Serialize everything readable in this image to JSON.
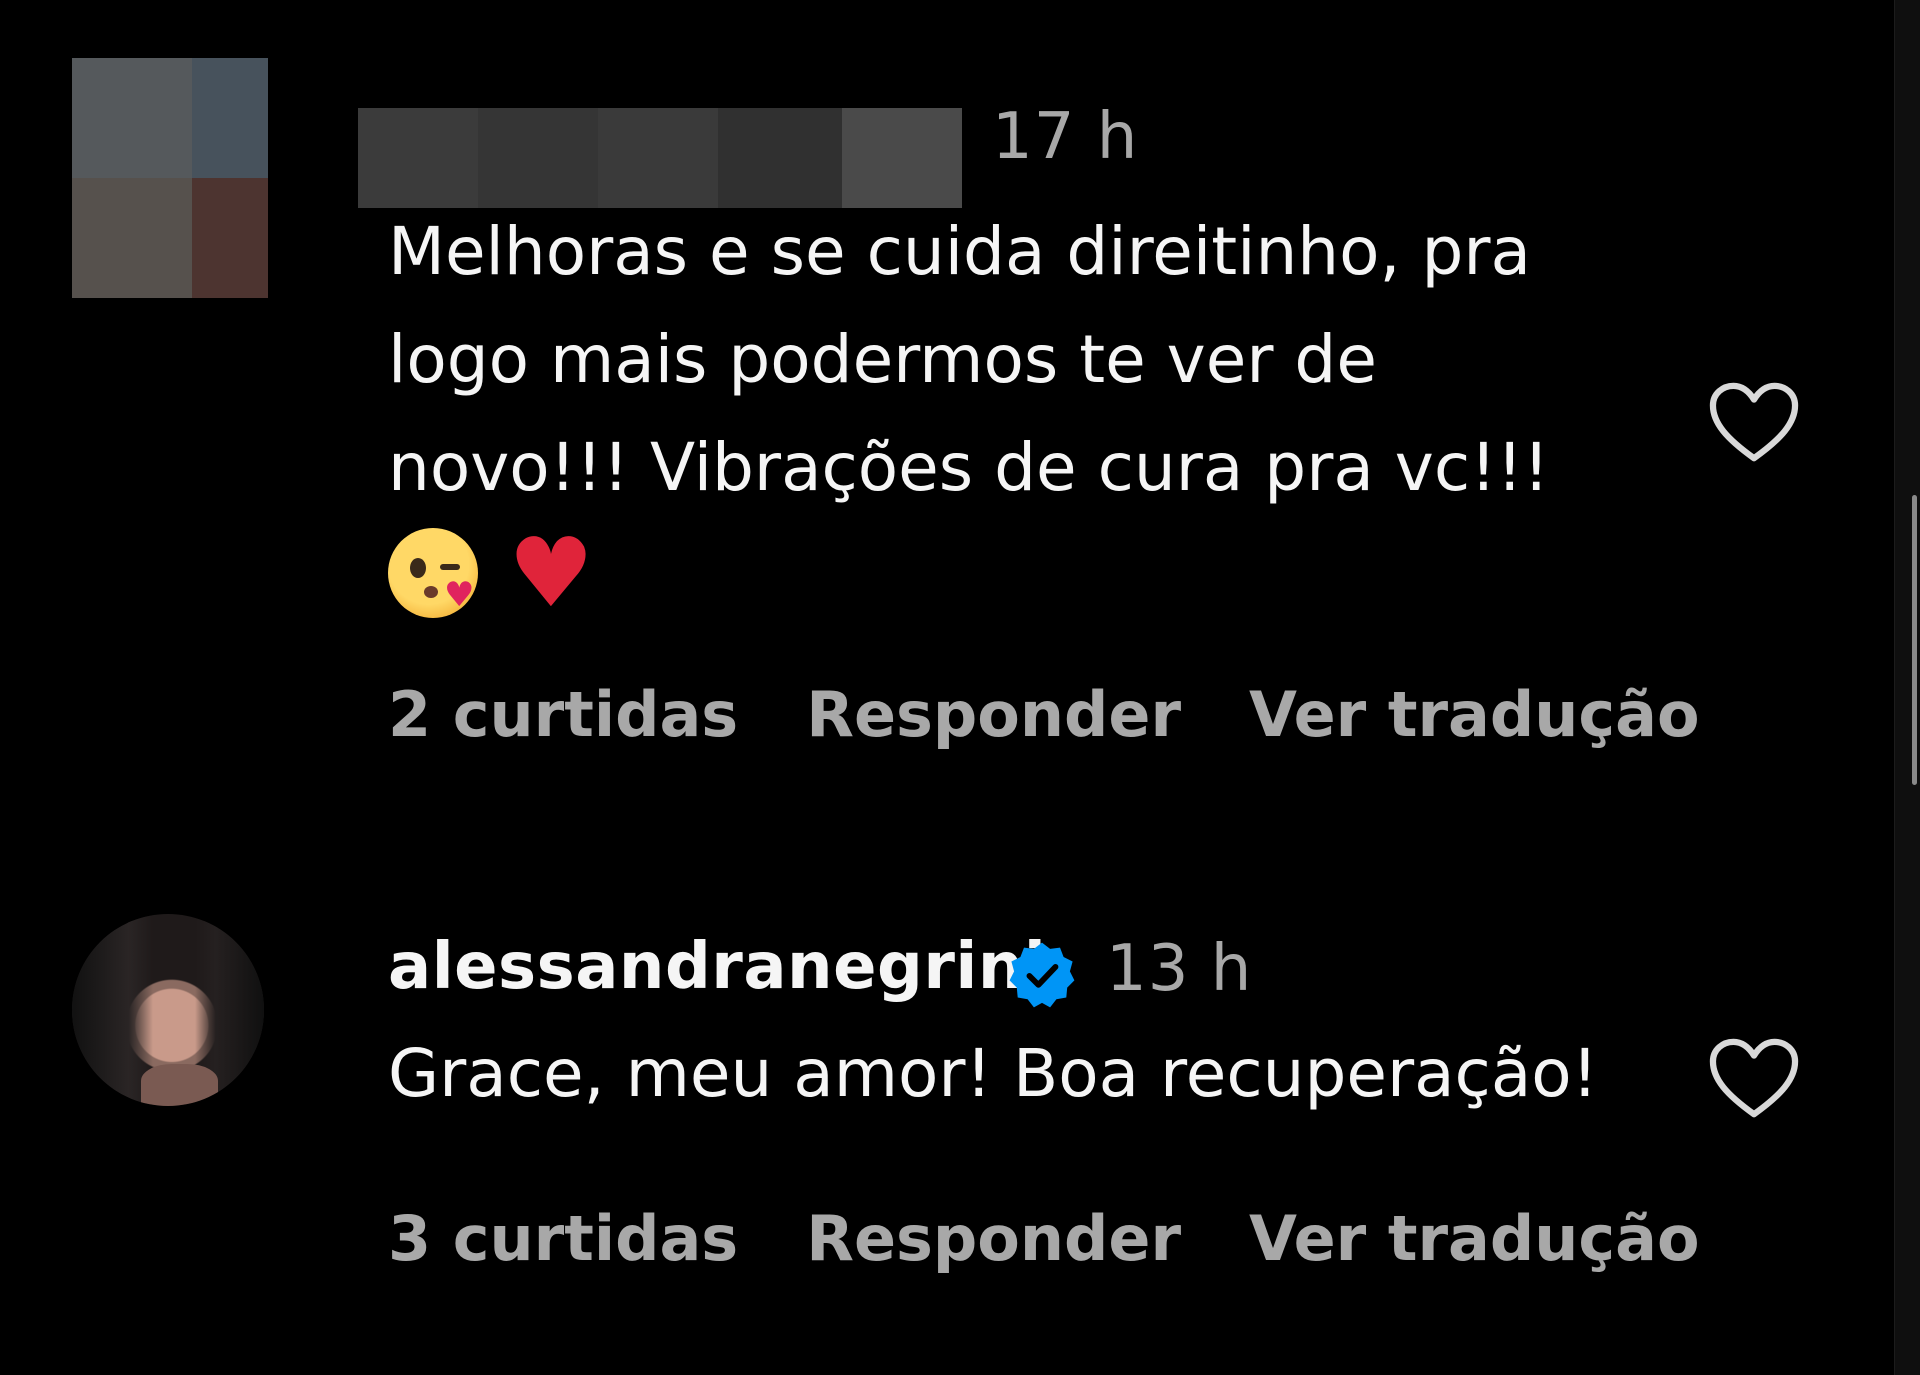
{
  "comments": [
    {
      "username": "",
      "username_redacted": true,
      "timestamp": "17 h",
      "text": "Melhoras e se cuida direitinho, pra\nlogo mais podermos te ver de\nnovo!!! Vibrações de cura pra vc!!!",
      "emojis": [
        "winking-face-kiss",
        "red-heart"
      ],
      "likes_label": "2 curtidas",
      "reply_label": "Responder",
      "translate_label": "Ver tradução"
    },
    {
      "username": "alessandranegrini",
      "verified": true,
      "timestamp": "13 h",
      "text": "Grace, meu amor! Boa recuperação!",
      "likes_label": "3 curtidas",
      "reply_label": "Responder",
      "translate_label": "Ver tradução"
    }
  ],
  "colors": {
    "background": "#000000",
    "text": "#f5f5f5",
    "secondary_text": "#a8a8a8",
    "verified_badge": "#0095f6"
  }
}
